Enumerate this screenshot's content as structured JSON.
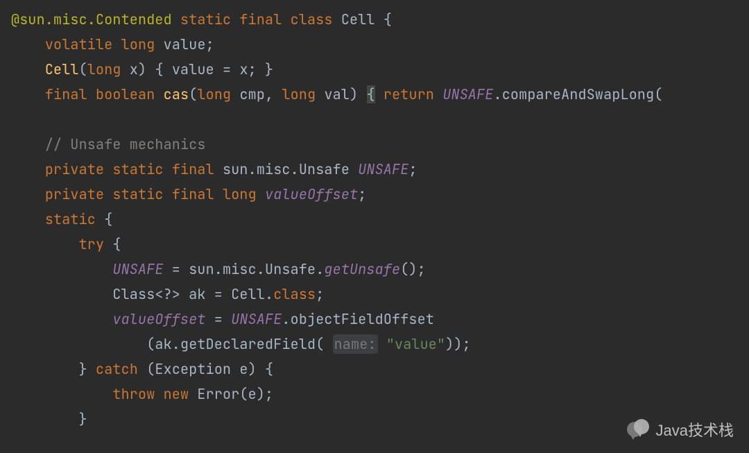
{
  "code": {
    "l1_ann": "@sun.misc.Contended",
    "l1_kw1": "static",
    "l1_kw2": "final",
    "l1_kw3": "class",
    "l1_class": "Cell",
    "l1_brace": "{",
    "l2_kw1": "volatile",
    "l2_kw2": "long",
    "l2_ident": "value",
    "l2_semi": ";",
    "l3_ctor": "Cell",
    "l3_p1": "(",
    "l3_kw": "long",
    "l3_var": "x",
    "l3_p2": ")",
    "l3_body": "{ value = x; }",
    "l4_kw1": "final",
    "l4_kw2": "boolean",
    "l4_method": "cas",
    "l4_p1": "(",
    "l4_kw3": "long",
    "l4_arg1": "cmp",
    "l4_comma": ",",
    "l4_kw4": "long",
    "l4_arg2": "val",
    "l4_p2": ")",
    "l4_brace": "{",
    "l4_kw5": "return",
    "l4_unsafe": "UNSAFE",
    "l4_dot": ".",
    "l4_call": "compareAndSwapLong(",
    "l5_cmt": "// Unsafe mechanics",
    "l6_kw1": "private",
    "l6_kw2": "static",
    "l6_kw3": "final",
    "l6_type": "sun.misc.Unsafe",
    "l6_field": "UNSAFE",
    "l6_semi": ";",
    "l7_kw1": "private",
    "l7_kw2": "static",
    "l7_kw3": "final",
    "l7_kw4": "long",
    "l7_field": "valueOffset",
    "l7_semi": ";",
    "l8_kw": "static",
    "l8_brace": "{",
    "l9_kw": "try",
    "l9_brace": "{",
    "l10_field": "UNSAFE",
    "l10_eq": " = sun.misc.Unsafe.",
    "l10_call": "getUnsafe",
    "l10_end": "();",
    "l11_txt": "Class<?> ak = Cell.",
    "l11_kw": "class",
    "l11_semi": ";",
    "l12_field": "valueOffset",
    "l12_eq": " = ",
    "l12_unsafe": "UNSAFE",
    "l12_dot": ".objectFieldOffset",
    "l13_p1": "(ak.getDeclaredField(",
    "l13_hint": "name:",
    "l13_str": "\"value\"",
    "l13_end": "));",
    "l14_rb": "}",
    "l14_kw": "catch",
    "l14_p1": "(Exception e)",
    "l14_brace": "{",
    "l15_kw1": "throw",
    "l15_kw2": "new",
    "l15_txt": "Error(e)",
    "l15_semi": ";",
    "l16_rb": "}"
  },
  "watermark": {
    "text": "Java技术栈",
    "icon": "wechat-bubbles-icon"
  }
}
